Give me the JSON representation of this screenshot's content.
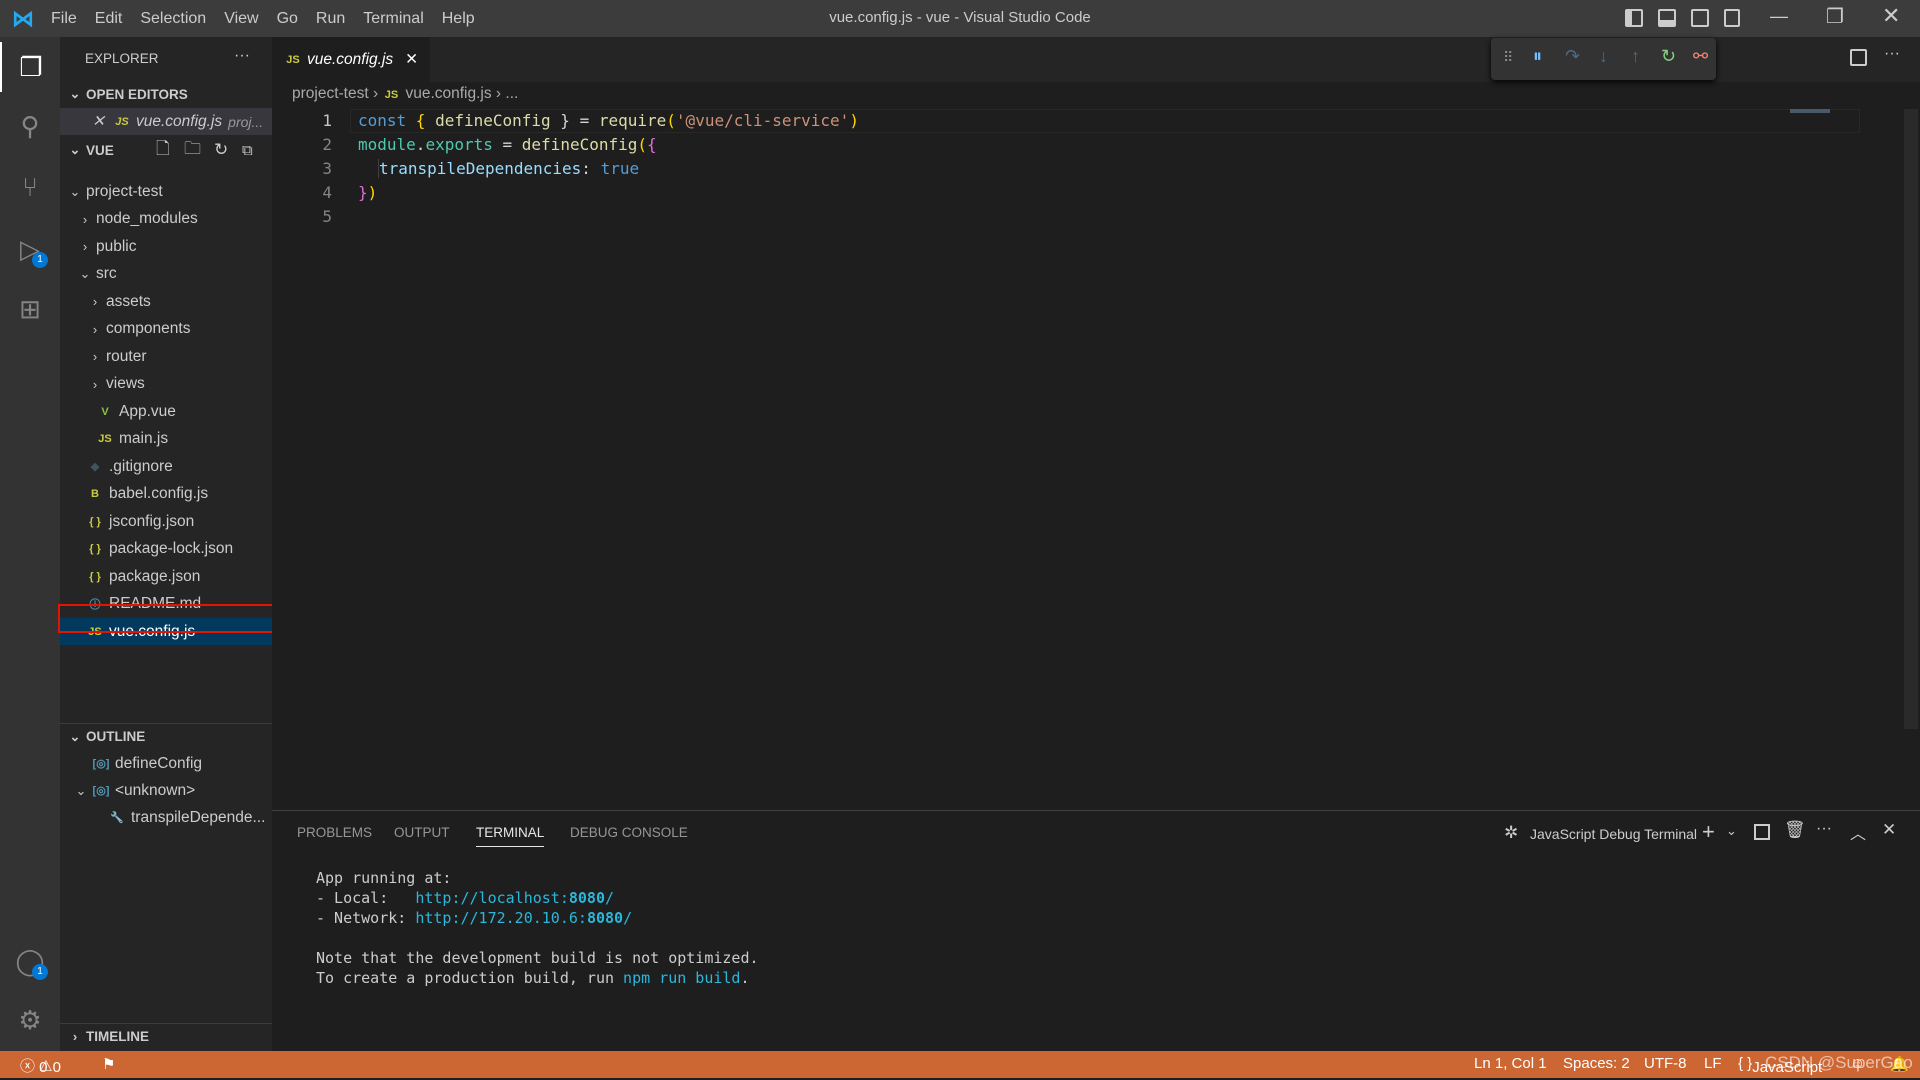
{
  "window": {
    "title": "vue.config.js - vue - Visual Studio Code",
    "menu": [
      "File",
      "Edit",
      "Selection",
      "View",
      "Go",
      "Run",
      "Terminal",
      "Help"
    ]
  },
  "activity": {
    "items": [
      "explorer-icon",
      "search-icon",
      "source-control-icon",
      "run-debug-icon",
      "extensions-icon"
    ],
    "debug_badge": "1",
    "account_badge": "1"
  },
  "sidebar": {
    "title": "EXPLORER",
    "more": "···",
    "open_editors": {
      "label": "OPEN EDITORS",
      "items": [
        {
          "icon": "JS",
          "name": "vue.config.js",
          "path": "proj..."
        }
      ]
    },
    "folder": {
      "label": "VUE"
    },
    "tree": [
      {
        "name": "project-test",
        "type": "folder-open",
        "depth": 0
      },
      {
        "name": "node_modules",
        "type": "folder",
        "depth": 1
      },
      {
        "name": "public",
        "type": "folder",
        "depth": 1
      },
      {
        "name": "src",
        "type": "folder-open",
        "depth": 1
      },
      {
        "name": "assets",
        "type": "folder",
        "depth": 2
      },
      {
        "name": "components",
        "type": "folder",
        "depth": 2
      },
      {
        "name": "router",
        "type": "folder",
        "depth": 2
      },
      {
        "name": "views",
        "type": "folder",
        "depth": 2
      },
      {
        "name": "App.vue",
        "type": "vue",
        "depth": 2
      },
      {
        "name": "main.js",
        "type": "js",
        "depth": 2
      },
      {
        "name": ".gitignore",
        "type": "git",
        "depth": 1
      },
      {
        "name": "babel.config.js",
        "type": "babel",
        "depth": 1
      },
      {
        "name": "jsconfig.json",
        "type": "json",
        "depth": 1
      },
      {
        "name": "package-lock.json",
        "type": "json",
        "depth": 1
      },
      {
        "name": "package.json",
        "type": "json",
        "depth": 1
      },
      {
        "name": "README.md",
        "type": "info",
        "depth": 1
      },
      {
        "name": "vue.config.js",
        "type": "js",
        "depth": 1,
        "selected": true
      }
    ],
    "outline": {
      "label": "OUTLINE",
      "items": [
        "defineConfig",
        "<unknown>",
        "transpileDepende..."
      ]
    },
    "timeline": {
      "label": "TIMELINE"
    }
  },
  "editor": {
    "tab": {
      "icon": "JS",
      "name": "vue.config.js"
    },
    "breadcrumb": [
      "project-test",
      "vue.config.js",
      "..."
    ],
    "lines": [
      "1",
      "2",
      "3",
      "4",
      "5"
    ],
    "code": {
      "l1": [
        "const",
        " { ",
        "defineConfig",
        " } = ",
        "require",
        "(",
        "'@vue/cli-service'",
        ")"
      ],
      "l2": [
        "module",
        ".",
        "exports",
        " = ",
        "defineConfig",
        "(",
        "{"
      ],
      "l3": [
        "transpileDependencies",
        ": ",
        "true"
      ],
      "l4": [
        "}",
        ")"
      ]
    }
  },
  "panel": {
    "tabs": [
      "PROBLEMS",
      "OUTPUT",
      "TERMINAL",
      "DEBUG CONSOLE"
    ],
    "active_tab": "TERMINAL",
    "terminal_name": "JavaScript Debug Terminal",
    "output": {
      "l1": "App running at:",
      "l2_label": "- Local:   ",
      "l2_url": "http://localhost:",
      "l2_port": "8080",
      "l2_end": "/",
      "l3_label": "- Network: ",
      "l3_url": "http://172.20.10.6:",
      "l3_port": "8080",
      "l3_end": "/",
      "l5": "Note that the development build is not optimized.",
      "l6_pre": "To create a production build, run ",
      "l6_cmd": "npm run build",
      "l6_end": "."
    }
  },
  "status": {
    "errors": "0",
    "warnings": "0",
    "position": "Ln 1, Col 1",
    "spaces": "Spaces: 2",
    "encoding": "UTF-8",
    "eol": "LF",
    "language": "JavaScript",
    "watermark": "CSDN @SuperGao"
  },
  "colors": {
    "status_bar": "#cc6633",
    "accent": "#0078d4",
    "selection_outline": "#e51400"
  }
}
